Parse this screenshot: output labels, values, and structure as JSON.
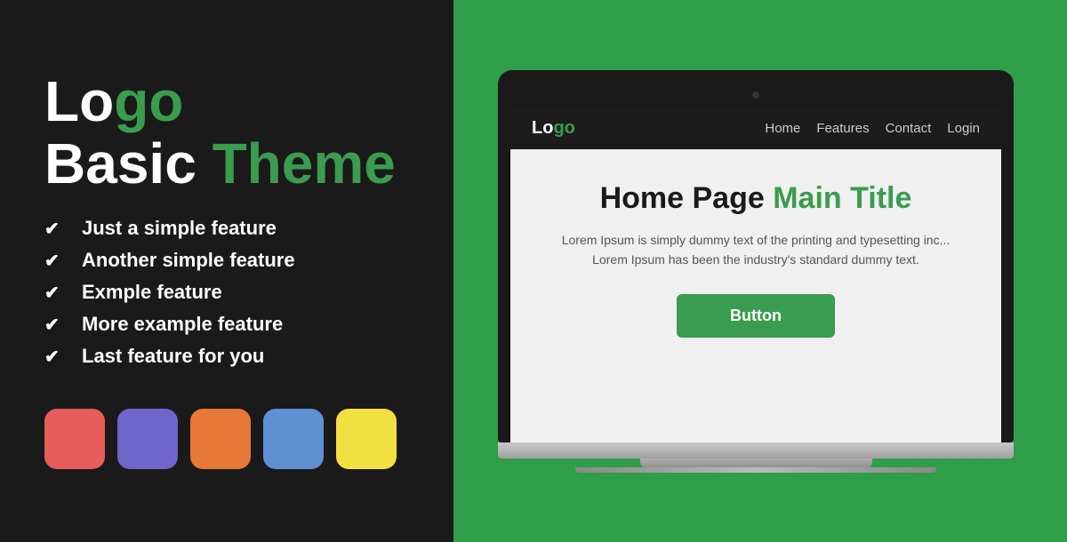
{
  "left": {
    "logo_text": "Logo",
    "logo_green_char": "o",
    "basic_label": "Basic ",
    "theme_label": "Theme",
    "features": [
      "Just a simple feature",
      "Another simple feature",
      "Exmple feature",
      "More example feature",
      "Last feature for you"
    ],
    "swatches": [
      {
        "color": "#e85c5c",
        "name": "red-swatch"
      },
      {
        "color": "#7065c8",
        "name": "purple-swatch"
      },
      {
        "color": "#e8783a",
        "name": "orange-swatch"
      },
      {
        "color": "#6090d4",
        "name": "blue-swatch"
      },
      {
        "color": "#f0e040",
        "name": "yellow-swatch"
      }
    ]
  },
  "right": {
    "browser": {
      "logo": "Logo",
      "nav_links": [
        "Home",
        "Features",
        "Contact",
        "Login"
      ]
    },
    "page": {
      "title_black": "Home Page ",
      "title_green": "Main Title",
      "description": "Lorem Ipsum is simply dummy text of the printing and typesetting inc... Lorem Ipsum has been the industry's standard dummy text.",
      "button_label": "Button"
    }
  }
}
